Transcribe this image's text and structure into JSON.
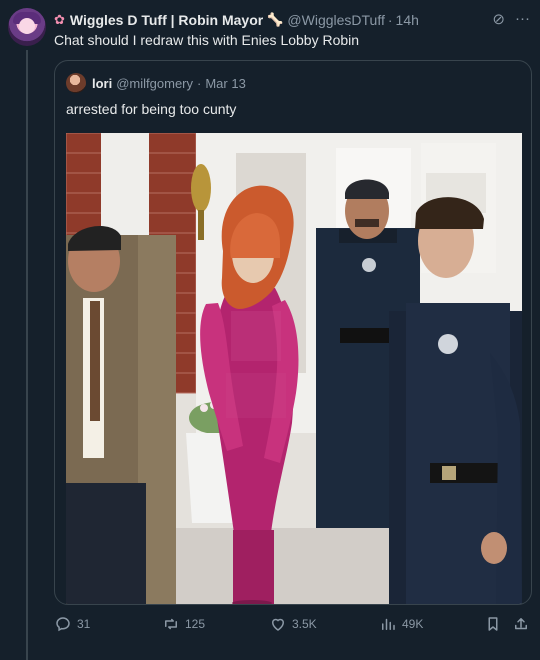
{
  "tweet": {
    "name": "Wiggles D Tuff | Robin Mayor",
    "handle": "@WigglesDTuff",
    "time": "14h",
    "text": "Chat should I redraw this with Enies Lobby Robin"
  },
  "quote": {
    "name": "lori",
    "handle": "@milfgomery",
    "time": "Mar 13",
    "text": "arrested for being too cunty"
  },
  "actions": {
    "replies": "31",
    "retweets": "125",
    "likes": "3.5K",
    "views": "49K"
  },
  "icons": {
    "flower": "flower-icon",
    "bone": "bone-icon",
    "grok": "grok-icon",
    "more": "more-icon",
    "reply": "reply-icon",
    "retweet": "retweet-icon",
    "like": "heart-icon",
    "views": "views-icon",
    "bookmark": "bookmark-icon",
    "share": "share-icon"
  }
}
